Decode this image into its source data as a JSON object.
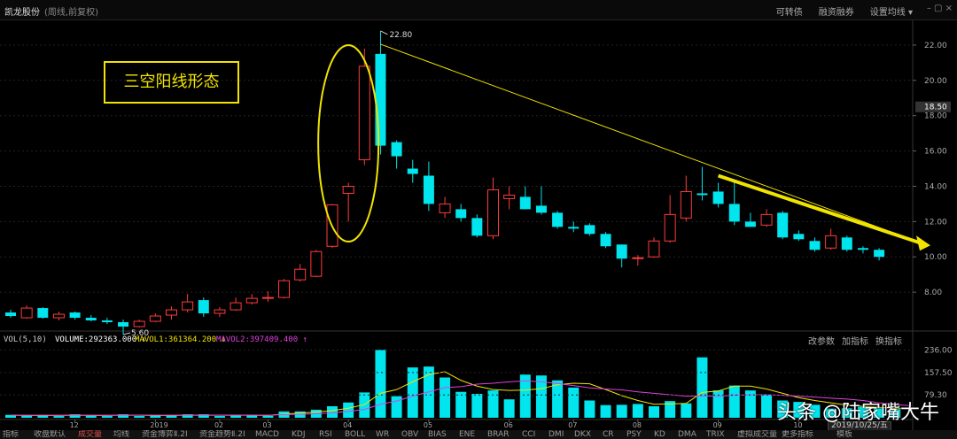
{
  "header": {
    "stock_name": "凯龙股份",
    "subtitle": "(周线,前复权)",
    "menu": [
      "可转债",
      "融资融券",
      "设置均线 ▾"
    ],
    "window_controls": "– ▢ ×"
  },
  "annotation": {
    "pattern_label": "三空阳线形态",
    "ellipse_color": "#f0e400",
    "arrow_color": "#f0e400"
  },
  "volume_bar": {
    "vol_label": "VOL(5,10)",
    "volume_text": "VOLUME:292363.000 ↓",
    "mavol1_text": "MAVOL1:361364.200 ↓",
    "mavol2_text": "MAVOL2:397409.400 ↑",
    "buttons": [
      "改参数",
      "加指标",
      "换指标"
    ]
  },
  "tabs": [
    {
      "label": "指标",
      "active": false
    },
    {
      "label": "收盘默认",
      "active": false
    },
    {
      "label": "成交量",
      "active": true
    },
    {
      "label": "均线",
      "active": false
    },
    {
      "label": "资金博弈Ⅱ.2I",
      "active": false
    },
    {
      "label": "资金趋势Ⅱ.2I",
      "active": false
    },
    {
      "label": "MACD",
      "active": false
    },
    {
      "label": "KDJ",
      "active": false
    },
    {
      "label": "RSI",
      "active": false
    },
    {
      "label": "BOLL",
      "active": false
    },
    {
      "label": "WR",
      "active": false
    },
    {
      "label": "OBV",
      "active": false
    },
    {
      "label": "BIAS",
      "active": false
    },
    {
      "label": "ENE",
      "active": false
    },
    {
      "label": "BRAR",
      "active": false
    },
    {
      "label": "CCI",
      "active": false
    },
    {
      "label": "DMI",
      "active": false
    },
    {
      "label": "DKX",
      "active": false
    },
    {
      "label": "CR",
      "active": false
    },
    {
      "label": "PSY",
      "active": false
    },
    {
      "label": "KD",
      "active": false
    },
    {
      "label": "DMA",
      "active": false
    },
    {
      "label": "TRIX",
      "active": false
    },
    {
      "label": "虚拟成交量",
      "active": false
    },
    {
      "label": "更多指标",
      "active": false
    },
    {
      "label": "模板",
      "active": false
    }
  ],
  "date_box": "2019/10/25/五",
  "watermark": "头条 @陆家嘴大牛",
  "chart_data": [
    {
      "type": "candlestick",
      "title": "",
      "price_axis": {
        "ticks": [
          8.0,
          10.0,
          12.0,
          14.0,
          16.0,
          18.0,
          20.0,
          22.0
        ],
        "ylim": [
          6.0,
          23.4
        ]
      },
      "current_price_label": "18.50",
      "high_label": "22.80",
      "low_label": "5.60",
      "x_tick_labels": [
        {
          "label": "12",
          "index": 4
        },
        {
          "label": "2019",
          "index": 9
        },
        {
          "label": "02",
          "index": 13
        },
        {
          "label": "03",
          "index": 16
        },
        {
          "label": "04",
          "index": 21
        },
        {
          "label": "05",
          "index": 26
        },
        {
          "label": "06",
          "index": 31
        },
        {
          "label": "07",
          "index": 35
        },
        {
          "label": "08",
          "index": 39
        },
        {
          "label": "09",
          "index": 44
        },
        {
          "label": "10",
          "index": 49
        }
      ],
      "colors": {
        "up": "#ff3b3b",
        "down": "#00e5ee"
      },
      "candles": [
        {
          "o": 6.85,
          "h": 7.0,
          "l": 6.55,
          "c": 6.65
        },
        {
          "o": 6.55,
          "h": 7.25,
          "l": 6.5,
          "c": 7.1
        },
        {
          "o": 7.1,
          "h": 7.15,
          "l": 6.5,
          "c": 6.55
        },
        {
          "o": 6.55,
          "h": 6.9,
          "l": 6.4,
          "c": 6.75
        },
        {
          "o": 6.85,
          "h": 6.9,
          "l": 6.45,
          "c": 6.55
        },
        {
          "o": 6.55,
          "h": 6.7,
          "l": 6.35,
          "c": 6.4
        },
        {
          "o": 6.4,
          "h": 6.55,
          "l": 6.2,
          "c": 6.3
        },
        {
          "o": 6.3,
          "h": 6.45,
          "l": 5.6,
          "c": 6.05
        },
        {
          "o": 6.05,
          "h": 6.45,
          "l": 6.0,
          "c": 6.35
        },
        {
          "o": 6.35,
          "h": 6.8,
          "l": 6.3,
          "c": 6.65
        },
        {
          "o": 6.7,
          "h": 7.2,
          "l": 6.45,
          "c": 7.0
        },
        {
          "o": 7.0,
          "h": 7.9,
          "l": 6.85,
          "c": 7.45
        },
        {
          "o": 7.55,
          "h": 7.7,
          "l": 6.6,
          "c": 6.8
        },
        {
          "o": 6.8,
          "h": 7.15,
          "l": 6.6,
          "c": 7.0
        },
        {
          "o": 7.0,
          "h": 7.7,
          "l": 6.95,
          "c": 7.4
        },
        {
          "o": 7.4,
          "h": 7.9,
          "l": 7.3,
          "c": 7.65
        },
        {
          "o": 7.65,
          "h": 8.05,
          "l": 7.45,
          "c": 7.7
        },
        {
          "o": 7.7,
          "h": 8.75,
          "l": 7.65,
          "c": 8.65
        },
        {
          "o": 8.7,
          "h": 9.6,
          "l": 8.6,
          "c": 9.3
        },
        {
          "o": 8.9,
          "h": 10.4,
          "l": 8.85,
          "c": 10.3
        },
        {
          "o": 10.6,
          "h": 13.0,
          "l": 10.5,
          "c": 12.95
        },
        {
          "o": 13.6,
          "h": 14.2,
          "l": 12.0,
          "c": 14.0
        },
        {
          "o": 15.5,
          "h": 21.8,
          "l": 15.2,
          "c": 20.8
        },
        {
          "o": 21.5,
          "h": 22.8,
          "l": 15.8,
          "c": 16.3
        },
        {
          "o": 16.5,
          "h": 16.6,
          "l": 15.0,
          "c": 15.7
        },
        {
          "o": 15.0,
          "h": 15.5,
          "l": 14.2,
          "c": 14.7
        },
        {
          "o": 14.6,
          "h": 15.4,
          "l": 12.6,
          "c": 13.0
        },
        {
          "o": 12.5,
          "h": 13.4,
          "l": 12.2,
          "c": 13.0
        },
        {
          "o": 12.7,
          "h": 13.0,
          "l": 12.0,
          "c": 12.2
        },
        {
          "o": 12.2,
          "h": 12.4,
          "l": 11.1,
          "c": 11.2
        },
        {
          "o": 11.2,
          "h": 14.5,
          "l": 11.0,
          "c": 13.8
        },
        {
          "o": 13.3,
          "h": 14.0,
          "l": 12.7,
          "c": 13.5
        },
        {
          "o": 13.4,
          "h": 14.0,
          "l": 12.7,
          "c": 12.7
        },
        {
          "o": 12.9,
          "h": 14.0,
          "l": 12.4,
          "c": 12.5
        },
        {
          "o": 12.5,
          "h": 12.6,
          "l": 11.6,
          "c": 11.7
        },
        {
          "o": 11.7,
          "h": 12.0,
          "l": 11.4,
          "c": 11.6
        },
        {
          "o": 11.8,
          "h": 11.9,
          "l": 11.2,
          "c": 11.3
        },
        {
          "o": 11.3,
          "h": 11.4,
          "l": 10.5,
          "c": 10.6
        },
        {
          "o": 10.7,
          "h": 10.7,
          "l": 9.4,
          "c": 9.9
        },
        {
          "o": 9.9,
          "h": 10.1,
          "l": 9.5,
          "c": 9.95
        },
        {
          "o": 10.0,
          "h": 11.1,
          "l": 9.95,
          "c": 10.9
        },
        {
          "o": 10.9,
          "h": 13.5,
          "l": 10.8,
          "c": 12.4
        },
        {
          "o": 12.2,
          "h": 14.6,
          "l": 12.0,
          "c": 13.7
        },
        {
          "o": 13.6,
          "h": 15.1,
          "l": 13.2,
          "c": 13.5
        },
        {
          "o": 13.7,
          "h": 14.2,
          "l": 12.8,
          "c": 13.0
        },
        {
          "o": 13.0,
          "h": 14.2,
          "l": 11.8,
          "c": 12.0
        },
        {
          "o": 12.0,
          "h": 12.5,
          "l": 11.8,
          "c": 11.7
        },
        {
          "o": 11.8,
          "h": 12.7,
          "l": 11.7,
          "c": 12.4
        },
        {
          "o": 12.5,
          "h": 12.6,
          "l": 11.0,
          "c": 11.1
        },
        {
          "o": 11.3,
          "h": 11.5,
          "l": 10.9,
          "c": 11.0
        },
        {
          "o": 10.9,
          "h": 11.1,
          "l": 10.3,
          "c": 10.4
        },
        {
          "o": 10.5,
          "h": 11.6,
          "l": 10.4,
          "c": 11.2
        },
        {
          "o": 11.1,
          "h": 11.2,
          "l": 10.3,
          "c": 10.4
        },
        {
          "o": 10.5,
          "h": 10.6,
          "l": 10.2,
          "c": 10.4
        },
        {
          "o": 10.4,
          "h": 10.5,
          "l": 9.8,
          "c": 10.0
        }
      ]
    },
    {
      "type": "bar",
      "title": "",
      "y_axis": {
        "ticks": [
          79.3,
          157.5,
          236.0
        ],
        "ylim": [
          0,
          240
        ]
      },
      "values": [
        10,
        7,
        8,
        6,
        12,
        7,
        6,
        12,
        6,
        8,
        8,
        12,
        12,
        6,
        8,
        9,
        7,
        22,
        22,
        28,
        40,
        53,
        88,
        236,
        75,
        175,
        178,
        140,
        90,
        83,
        95,
        64,
        150,
        147,
        130,
        105,
        60,
        44,
        45,
        48,
        40,
        58,
        50,
        210,
        95,
        112,
        95,
        80,
        60,
        55,
        45,
        32,
        33,
        38,
        33,
        30,
        35
      ],
      "mavol1": [
        9,
        8,
        8,
        8,
        9,
        8,
        8,
        9,
        9,
        8,
        8,
        9,
        9,
        9,
        9,
        9,
        8,
        13,
        16,
        20,
        25,
        33,
        46,
        85,
        98,
        125,
        150,
        160,
        130,
        110,
        98,
        95,
        96,
        101,
        115,
        120,
        118,
        98,
        77,
        60,
        47,
        48,
        50,
        88,
        93,
        110,
        110,
        100,
        85,
        70,
        60,
        52,
        44,
        40,
        36,
        33,
        33
      ],
      "mavol2": [
        9,
        9,
        9,
        9,
        9,
        9,
        9,
        9,
        9,
        9,
        9,
        9,
        9,
        9,
        9,
        9,
        9,
        11,
        12,
        14,
        17,
        22,
        29,
        47,
        58,
        75,
        90,
        105,
        108,
        117,
        120,
        125,
        128,
        125,
        119,
        112,
        104,
        100,
        97,
        90,
        85,
        80,
        75,
        76,
        75,
        78,
        80,
        80,
        78,
        75,
        72,
        68,
        65,
        60,
        52,
        46,
        42
      ],
      "colors": {
        "volume": "#00e5ee",
        "mavol1": "#f0e400",
        "mavol2": "#e040e0"
      },
      "mavol_scale_note": ""
    }
  ]
}
